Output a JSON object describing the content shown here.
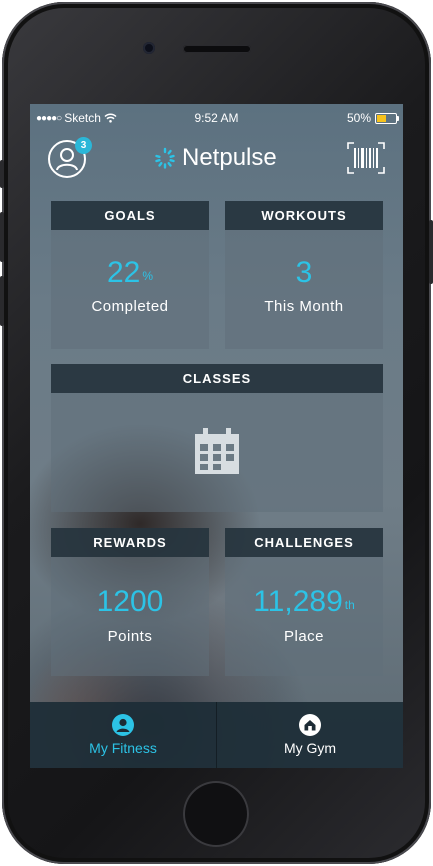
{
  "status_bar": {
    "carrier": "Sketch",
    "time": "9:52 AM",
    "battery_percent": "50%",
    "battery_level": 0.5,
    "battery_color": "#f6c21c"
  },
  "header": {
    "notification_count": "3",
    "brand_name": "Netpulse",
    "profile_icon": "user-circle-icon",
    "scan_icon": "barcode-icon"
  },
  "tiles": {
    "goals": {
      "title": "GOALS",
      "value": "22",
      "unit": "%",
      "caption": "Completed"
    },
    "workouts": {
      "title": "WORKOUTS",
      "value": "3",
      "caption": "This Month"
    },
    "classes": {
      "title": "CLASSES",
      "icon": "calendar-icon"
    },
    "rewards": {
      "title": "REWARDS",
      "value": "1200",
      "caption": "Points"
    },
    "challenges": {
      "title": "CHALLENGES",
      "value": "11,289",
      "suffix": "th",
      "caption": "Place"
    }
  },
  "tabbar": {
    "tabs": [
      {
        "label": "My Fitness",
        "icon": "user-circle-icon",
        "active": true
      },
      {
        "label": "My Gym",
        "icon": "home-icon",
        "active": false
      }
    ]
  },
  "colors": {
    "accent": "#2cc3e6",
    "badge": "#2bb7d8",
    "tile_header": "#212f38",
    "tabbar": "#1c2c36"
  }
}
